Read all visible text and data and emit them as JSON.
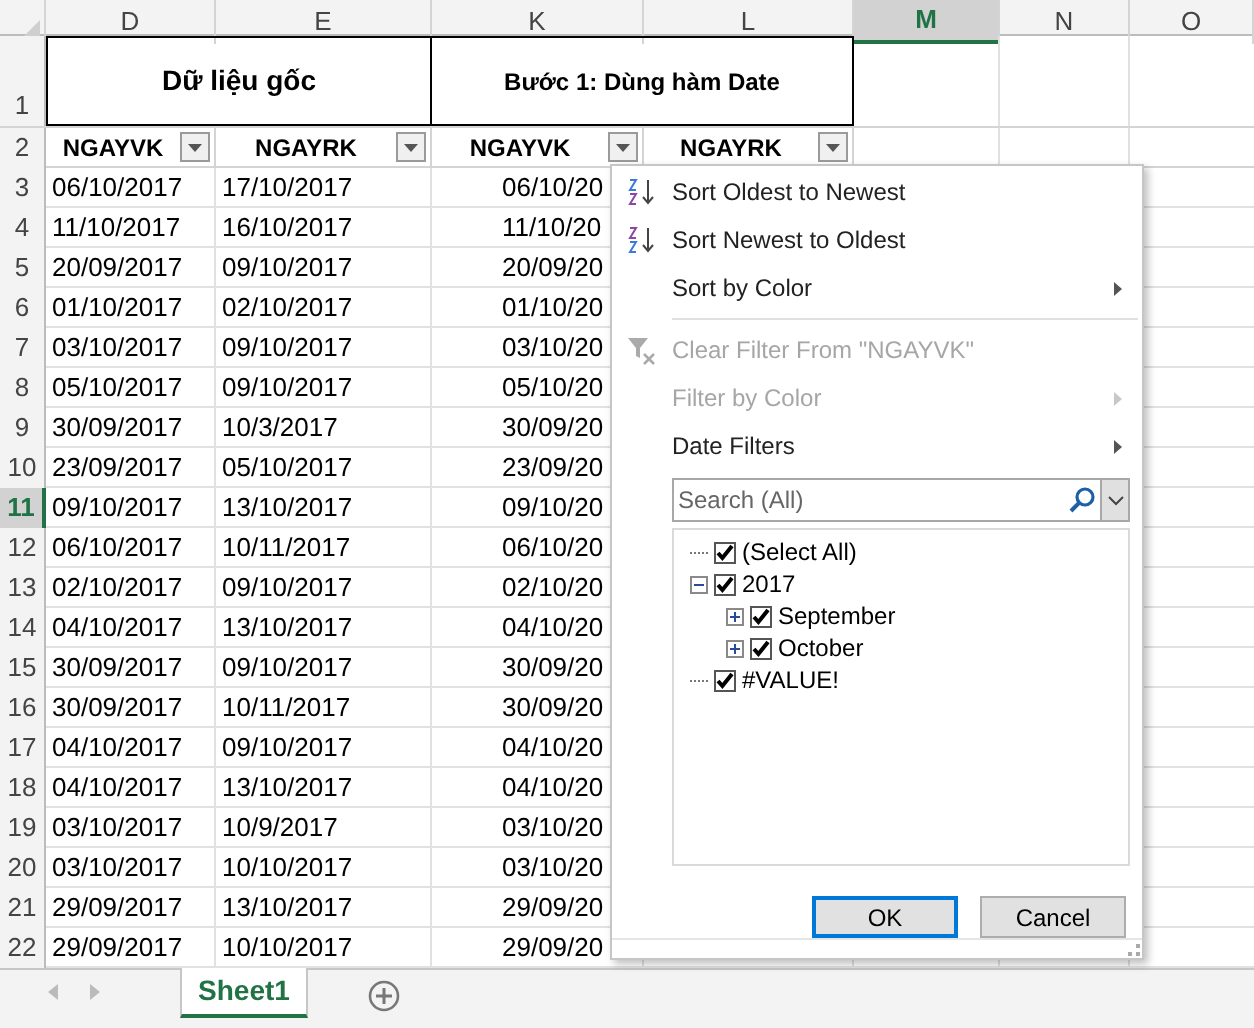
{
  "column_headers": [
    {
      "label": "D",
      "selected": false
    },
    {
      "label": "E",
      "selected": false
    },
    {
      "label": "K",
      "selected": false
    },
    {
      "label": "L",
      "selected": false
    },
    {
      "label": "M",
      "selected": true
    },
    {
      "label": "N",
      "selected": false
    },
    {
      "label": "O",
      "selected": false
    }
  ],
  "title_row": {
    "number": "1",
    "left": "Dữ liệu gốc",
    "right": "Bước 1: Dùng hàm Date"
  },
  "header_row": {
    "number": "2",
    "columns": [
      "NGAYVK",
      "NGAYRK",
      "NGAYVK",
      "NGAYRK"
    ]
  },
  "rows": [
    {
      "number": "3",
      "selected": false,
      "cells": [
        "06/10/2017",
        "17/10/2017",
        "06/10/20"
      ]
    },
    {
      "number": "4",
      "selected": false,
      "cells": [
        "11/10/2017",
        "16/10/2017",
        "11/10/20"
      ]
    },
    {
      "number": "5",
      "selected": false,
      "cells": [
        "20/09/2017",
        "09/10/2017",
        "20/09/20"
      ]
    },
    {
      "number": "6",
      "selected": false,
      "cells": [
        "01/10/2017",
        "02/10/2017",
        "01/10/20"
      ]
    },
    {
      "number": "7",
      "selected": false,
      "cells": [
        "03/10/2017",
        "09/10/2017",
        "03/10/20"
      ]
    },
    {
      "number": "8",
      "selected": false,
      "cells": [
        "05/10/2017",
        "09/10/2017",
        "05/10/20"
      ]
    },
    {
      "number": "9",
      "selected": false,
      "cells": [
        "30/09/2017",
        "10/3/2017",
        "30/09/20"
      ]
    },
    {
      "number": "10",
      "selected": false,
      "cells": [
        "23/09/2017",
        "05/10/2017",
        "23/09/20"
      ]
    },
    {
      "number": "11",
      "selected": true,
      "cells": [
        "09/10/2017",
        "13/10/2017",
        "09/10/20"
      ]
    },
    {
      "number": "12",
      "selected": false,
      "cells": [
        "06/10/2017",
        "10/11/2017",
        "06/10/20"
      ]
    },
    {
      "number": "13",
      "selected": false,
      "cells": [
        "02/10/2017",
        "09/10/2017",
        "02/10/20"
      ]
    },
    {
      "number": "14",
      "selected": false,
      "cells": [
        "04/10/2017",
        "13/10/2017",
        "04/10/20"
      ]
    },
    {
      "number": "15",
      "selected": false,
      "cells": [
        "30/09/2017",
        "09/10/2017",
        "30/09/20"
      ]
    },
    {
      "number": "16",
      "selected": false,
      "cells": [
        "30/09/2017",
        "10/11/2017",
        "30/09/20"
      ]
    },
    {
      "number": "17",
      "selected": false,
      "cells": [
        "04/10/2017",
        "09/10/2017",
        "04/10/20"
      ]
    },
    {
      "number": "18",
      "selected": false,
      "cells": [
        "04/10/2017",
        "13/10/2017",
        "04/10/20"
      ]
    },
    {
      "number": "19",
      "selected": false,
      "cells": [
        "03/10/2017",
        "10/9/2017",
        "03/10/20"
      ]
    },
    {
      "number": "20",
      "selected": false,
      "cells": [
        "03/10/2017",
        "10/10/2017",
        "03/10/20"
      ]
    },
    {
      "number": "21",
      "selected": false,
      "cells": [
        "29/09/2017",
        "13/10/2017",
        "29/09/20"
      ]
    },
    {
      "number": "22",
      "selected": false,
      "cells": [
        "29/09/2017",
        "10/10/2017",
        "29/09/20"
      ]
    }
  ],
  "filter_menu": {
    "items": [
      {
        "kind": "sort_asc",
        "label": "Sort Oldest to Newest",
        "disabled": false,
        "submenu": false
      },
      {
        "kind": "sort_desc",
        "label": "Sort Newest to Oldest",
        "disabled": false,
        "submenu": false
      },
      {
        "kind": "plain",
        "label": "Sort by Color",
        "disabled": false,
        "submenu": true
      },
      {
        "kind": "separator"
      },
      {
        "kind": "clear",
        "label": "Clear Filter From \"NGAYVK\"",
        "disabled": true,
        "submenu": false
      },
      {
        "kind": "plain",
        "label": "Filter by Color",
        "disabled": true,
        "submenu": true
      },
      {
        "kind": "plain",
        "label": "Date Filters",
        "disabled": false,
        "submenu": true
      }
    ],
    "search": {
      "placeholder": "Search (All)"
    },
    "tree": [
      {
        "label": "(Select All)",
        "checked": true
      },
      {
        "label": "2017",
        "checked": true,
        "expanded": true,
        "children": [
          {
            "label": "September",
            "checked": true,
            "expanded": false
          },
          {
            "label": "October",
            "checked": true,
            "expanded": false
          }
        ]
      },
      {
        "label": "#VALUE!",
        "checked": true
      }
    ],
    "buttons": [
      {
        "label": "OK",
        "default": true
      },
      {
        "label": "Cancel",
        "default": false
      }
    ]
  },
  "sheet_tabs": [
    {
      "label": "Sheet1",
      "selected": true
    }
  ]
}
